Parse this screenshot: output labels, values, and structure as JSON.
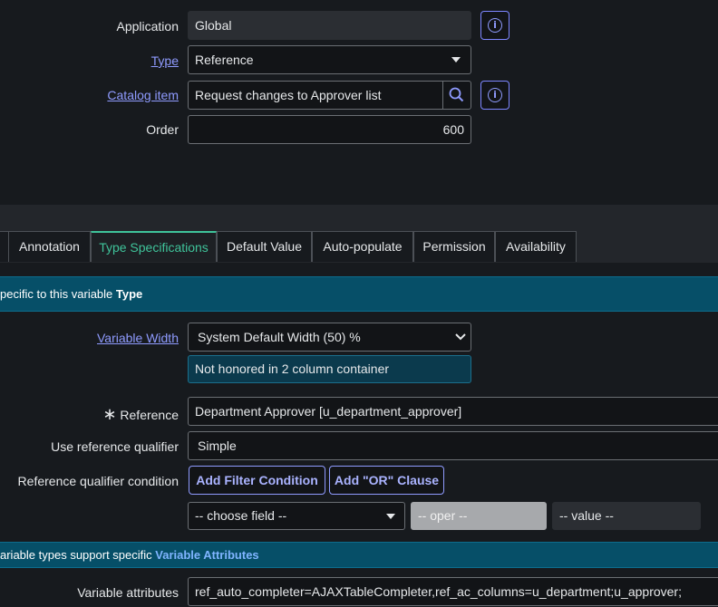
{
  "form": {
    "application_label": "Application",
    "application_value": "Global",
    "type_label": "Type",
    "type_value": "Reference",
    "catalog_item_label": "Catalog item",
    "catalog_item_value": "Request changes to Approver list",
    "order_label": "Order",
    "order_value": "600"
  },
  "tabs": [
    {
      "label": "Annotation"
    },
    {
      "label": "Type Specifications"
    },
    {
      "label": "Default Value"
    },
    {
      "label": "Auto-populate"
    },
    {
      "label": "Permission"
    },
    {
      "label": "Availability"
    }
  ],
  "active_tab": "Type Specifications",
  "type_specs": {
    "banner_prefix": "pecific to this variable ",
    "banner_bold": "Type",
    "variable_width_label": "Variable Width",
    "variable_width_value": "System Default Width (50) %",
    "variable_width_note": "Not honored in 2 column container",
    "reference_required_mark": "∗",
    "reference_label": "Reference",
    "reference_value": "Department Approver [u_department_approver]",
    "use_ref_qualifier_label": "Use reference qualifier",
    "use_ref_qualifier_value": "Simple",
    "ref_qual_condition_label": "Reference qualifier condition",
    "add_filter_button": "Add Filter Condition",
    "add_or_button": "Add \"OR\" Clause",
    "choose_field": "-- choose field --",
    "oper": "-- oper --",
    "value": "-- value --"
  },
  "attributes_section": {
    "banner_prefix": "ariable types support specific ",
    "banner_link": "Variable Attributes",
    "variable_attributes_label": "Variable attributes",
    "variable_attributes_value": "ref_auto_completer=AJAXTableCompleter,ref_ac_columns=u_department;u_approver;"
  },
  "colors": {
    "background": "#171a1e",
    "link": "#8f9bff",
    "active_tab": "#3fc39a",
    "section_banner": "#064f68"
  }
}
